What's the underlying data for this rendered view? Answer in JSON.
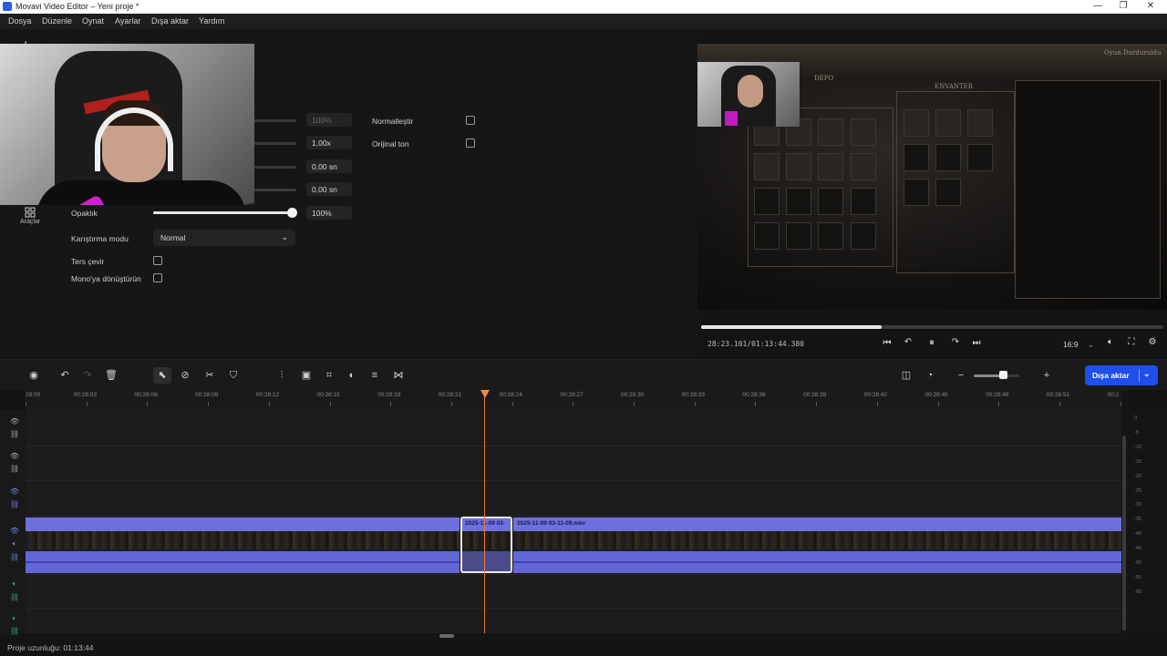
{
  "window": {
    "title": "Movavi Video Editor – Yeni proje *",
    "controls": {
      "minimize": "—",
      "maximize": "❐",
      "close": "✕"
    }
  },
  "menu": [
    "Dosya",
    "Düzenle",
    "Oynat",
    "Ayarlar",
    "Dışa aktar",
    "Yardım"
  ],
  "left_tools": {
    "tools_label": "Araçlar"
  },
  "properties": {
    "speed_value": "100%",
    "rate_value": "1,00x",
    "fade_in_value": "0,00 sn",
    "fade_out_value": "0,00 sn",
    "opacity_label": "Opaklık",
    "opacity_value": "100%",
    "opacity_level": 1.0,
    "blend_mode_label": "Karıştırma modu",
    "blend_mode_value": "Normal",
    "reverse_label": "Ters çevir",
    "mono_label": "Mono'ya dönüştürün",
    "normalize_label": "Normalleştir",
    "original_tone_label": "Orijinal ton"
  },
  "preview": {
    "scene_depot": "DEPO",
    "scene_inventory": "ENVANTER",
    "scene_corner": "Oyun Durduruldu"
  },
  "player": {
    "timecode": "28:23.101/01:13:44.380",
    "progress_fraction": 0.39,
    "aspect_ratio": "16:9",
    "icons": [
      "skip-back-icon",
      "undo-seek-icon",
      "pause-icon",
      "redo-seek-icon",
      "skip-forward-icon",
      "volume-icon",
      "fullscreen-icon",
      "settings-icon"
    ]
  },
  "toolbar": {
    "export_label": "Dışa aktar",
    "zoom_level": 0.64
  },
  "ruler": {
    "labels": [
      "28:00",
      "00:28:03",
      "00:28:06",
      "00:28:09",
      "00:28:12",
      "00:28:15",
      "00:28:18",
      "00:28:21",
      "00:28:24",
      "00:28:27",
      "00:28:30",
      "00:28:33",
      "00:28:36",
      "00:28:39",
      "00:28:42",
      "00:28:45",
      "00:28:48",
      "00:28:51",
      "00:2"
    ]
  },
  "clips": {
    "selected_clip_title": "2025-11-09 03-",
    "main_clip_title": "2025-11-09 03-11-09.mkv"
  },
  "meter": {
    "labels": [
      "0",
      "-5",
      "-10",
      "-15",
      "-20",
      "-25",
      "-30",
      "-35",
      "-40",
      "-45",
      "-50",
      "-55",
      "-60"
    ]
  },
  "status": {
    "project_length": "Proje uzunluğu: 01:13:44"
  },
  "colors": {
    "accent": "#1f4fe8",
    "clip": "#6e70e0",
    "playhead": "#e8773a"
  }
}
